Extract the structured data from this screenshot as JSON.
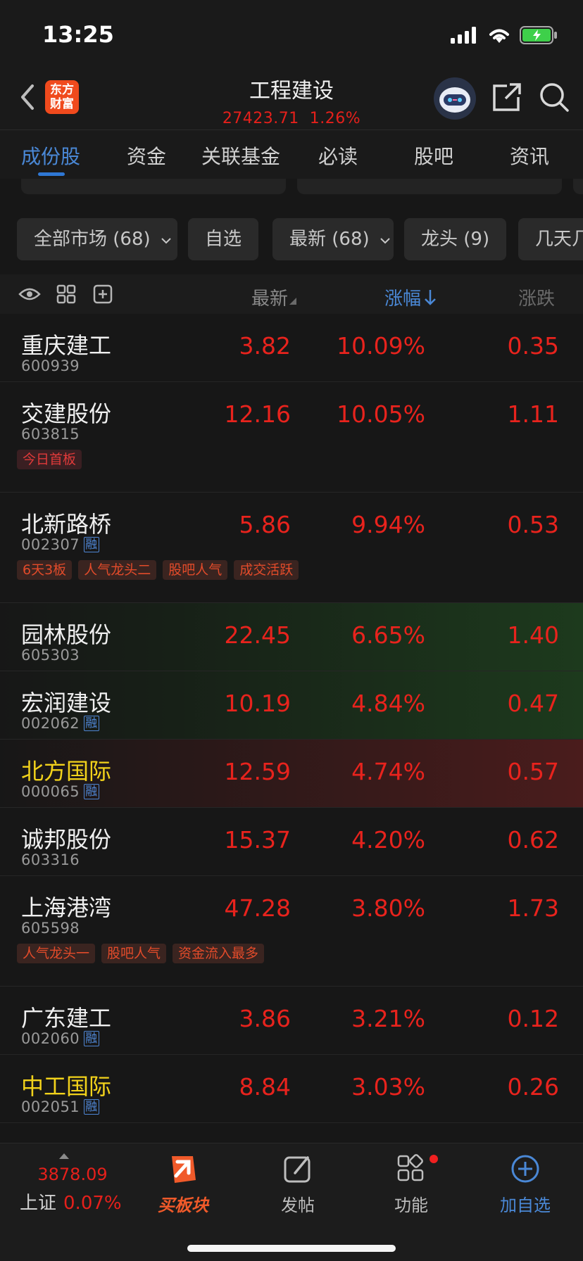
{
  "status_bar": {
    "time": "13:25"
  },
  "header": {
    "logo_text": "东方财富",
    "title": "工程建设",
    "index_value": "27423.71",
    "index_pct": "1.26%"
  },
  "tabs": [
    "成份股",
    "资金",
    "关联基金",
    "必读",
    "股吧",
    "资讯"
  ],
  "filters": [
    "全部市场 (68)",
    "自选",
    "最新 (68)",
    "龙头 (9)",
    "几天几"
  ],
  "columns": {
    "latest": "最新",
    "change_pct": "涨幅",
    "change": "涨跌"
  },
  "stocks": [
    {
      "name": "重庆建工",
      "code": "600939",
      "rong": "",
      "price": "3.82",
      "pct": "10.09%",
      "chg": "0.35",
      "tags": []
    },
    {
      "name": "交建股份",
      "code": "603815",
      "rong": "",
      "price": "12.16",
      "pct": "10.05%",
      "chg": "1.11",
      "tags": [
        "今日首板"
      ]
    },
    {
      "name": "北新路桥",
      "code": "002307",
      "rong": "融",
      "price": "5.86",
      "pct": "9.94%",
      "chg": "0.53",
      "tags": [
        "6天3板",
        "人气龙头二",
        "股吧人气",
        "成交活跃"
      ]
    },
    {
      "name": "园林股份",
      "code": "605303",
      "rong": "",
      "price": "22.45",
      "pct": "6.65%",
      "chg": "1.40",
      "tags": []
    },
    {
      "name": "宏润建设",
      "code": "002062",
      "rong": "融",
      "price": "10.19",
      "pct": "4.84%",
      "chg": "0.47",
      "tags": []
    },
    {
      "name": "北方国际",
      "code": "000065",
      "rong": "融",
      "price": "12.59",
      "pct": "4.74%",
      "chg": "0.57",
      "tags": []
    },
    {
      "name": "诚邦股份",
      "code": "603316",
      "rong": "",
      "price": "15.37",
      "pct": "4.20%",
      "chg": "0.62",
      "tags": []
    },
    {
      "name": "上海港湾",
      "code": "605598",
      "rong": "",
      "price": "47.28",
      "pct": "3.80%",
      "chg": "1.73",
      "tags": [
        "人气龙头一",
        "股吧人气",
        "资金流入最多"
      ]
    },
    {
      "name": "广东建工",
      "code": "002060",
      "rong": "融",
      "price": "3.86",
      "pct": "3.21%",
      "chg": "0.12",
      "tags": []
    },
    {
      "name": "中工国际",
      "code": "002051",
      "rong": "融",
      "price": "8.84",
      "pct": "3.03%",
      "chg": "0.26",
      "tags": []
    }
  ],
  "bottom": {
    "index_value": "3878.09",
    "index_name": "上证",
    "index_pct": "0.07%",
    "buy_sector": "买板块",
    "post": "发帖",
    "functions": "功能",
    "add_watch": "加自选"
  },
  "colors": {
    "up_red": "#e8231d",
    "accent_blue": "#4a88d6",
    "background": "#171717"
  }
}
